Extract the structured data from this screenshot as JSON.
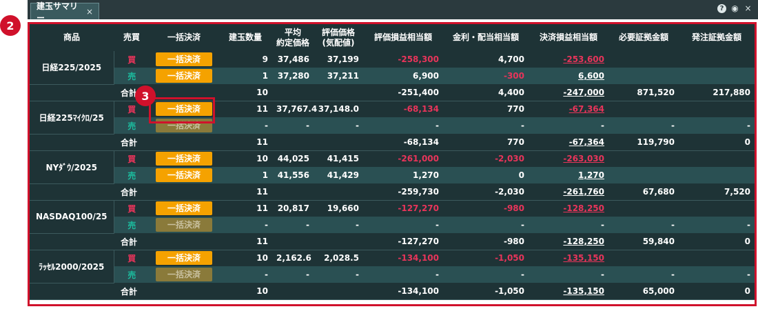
{
  "tab": {
    "title": "建玉サマリー",
    "close": "×"
  },
  "win_icons": {
    "help": "?",
    "eye": "◉",
    "close": "×"
  },
  "badges": {
    "b2": "2",
    "b3": "3"
  },
  "headers": [
    "商品",
    "売買",
    "一括決済",
    "建玉数量",
    "平均\n約定価格",
    "評価価格\n(気配値)",
    "評価損益相当額",
    "金利・配当相当額",
    "決済損益相当額",
    "必要証拠金額",
    "発注証拠金額"
  ],
  "products": [
    {
      "name": "日経225/2025",
      "buy": {
        "side": "買",
        "btn": "一括決済",
        "qty": "9",
        "avg": "37,486",
        "eval": "37,199",
        "pl": "-258,300",
        "int": "4,700",
        "settle": "-253,600"
      },
      "sell": {
        "side": "売",
        "btn": "一括決済",
        "qty": "1",
        "avg": "37,280",
        "eval": "37,211",
        "pl": "6,900",
        "int": "-300",
        "settle": "6,600"
      },
      "sum": {
        "label": "合計",
        "qty": "10",
        "pl": "-251,400",
        "int": "4,400",
        "settle": "-247,000",
        "req": "871,520",
        "order": "217,880"
      }
    },
    {
      "name": "日経225ﾏｲｸﾛ/25",
      "buy": {
        "side": "買",
        "btn": "一括決済",
        "qty": "11",
        "avg": "37,767.4",
        "eval": "37,148.0",
        "pl": "-68,134",
        "int": "770",
        "settle": "-67,364"
      },
      "sell": {
        "side": "売",
        "btn": "一括決済",
        "qty": "-",
        "avg": "-",
        "eval": "-",
        "pl": "-",
        "int": "-",
        "settle": "-"
      },
      "sum": {
        "label": "合計",
        "qty": "11",
        "pl": "-68,134",
        "int": "770",
        "settle": "-67,364",
        "req": "119,790",
        "order": "0"
      }
    },
    {
      "name": "NYﾀﾞｳ/2025",
      "buy": {
        "side": "買",
        "btn": "一括決済",
        "qty": "10",
        "avg": "44,025",
        "eval": "41,415",
        "pl": "-261,000",
        "int": "-2,030",
        "settle": "-263,030"
      },
      "sell": {
        "side": "売",
        "btn": "一括決済",
        "qty": "1",
        "avg": "41,556",
        "eval": "41,429",
        "pl": "1,270",
        "int": "0",
        "settle": "1,270"
      },
      "sum": {
        "label": "合計",
        "qty": "11",
        "pl": "-259,730",
        "int": "-2,030",
        "settle": "-261,760",
        "req": "67,680",
        "order": "7,520"
      }
    },
    {
      "name": "NASDAQ100/25",
      "buy": {
        "side": "買",
        "btn": "一括決済",
        "qty": "11",
        "avg": "20,817",
        "eval": "19,660",
        "pl": "-127,270",
        "int": "-980",
        "settle": "-128,250"
      },
      "sell": {
        "side": "売",
        "btn": "一括決済",
        "qty": "-",
        "avg": "-",
        "eval": "-",
        "pl": "-",
        "int": "-",
        "settle": "-"
      },
      "sum": {
        "label": "合計",
        "qty": "11",
        "pl": "-127,270",
        "int": "-980",
        "settle": "-128,250",
        "req": "59,840",
        "order": "0"
      }
    },
    {
      "name": "ﾗｯｾﾙ2000/2025",
      "buy": {
        "side": "買",
        "btn": "一括決済",
        "qty": "10",
        "avg": "2,162.6",
        "eval": "2,028.5",
        "pl": "-134,100",
        "int": "-1,050",
        "settle": "-135,150"
      },
      "sell": {
        "side": "売",
        "btn": "一括決済",
        "qty": "-",
        "avg": "-",
        "eval": "-",
        "pl": "-",
        "int": "-",
        "settle": "-"
      },
      "sum": {
        "label": "合計",
        "qty": "10",
        "pl": "-134,100",
        "int": "-1,050",
        "settle": "-135,150",
        "req": "65,000",
        "order": "0"
      }
    }
  ]
}
